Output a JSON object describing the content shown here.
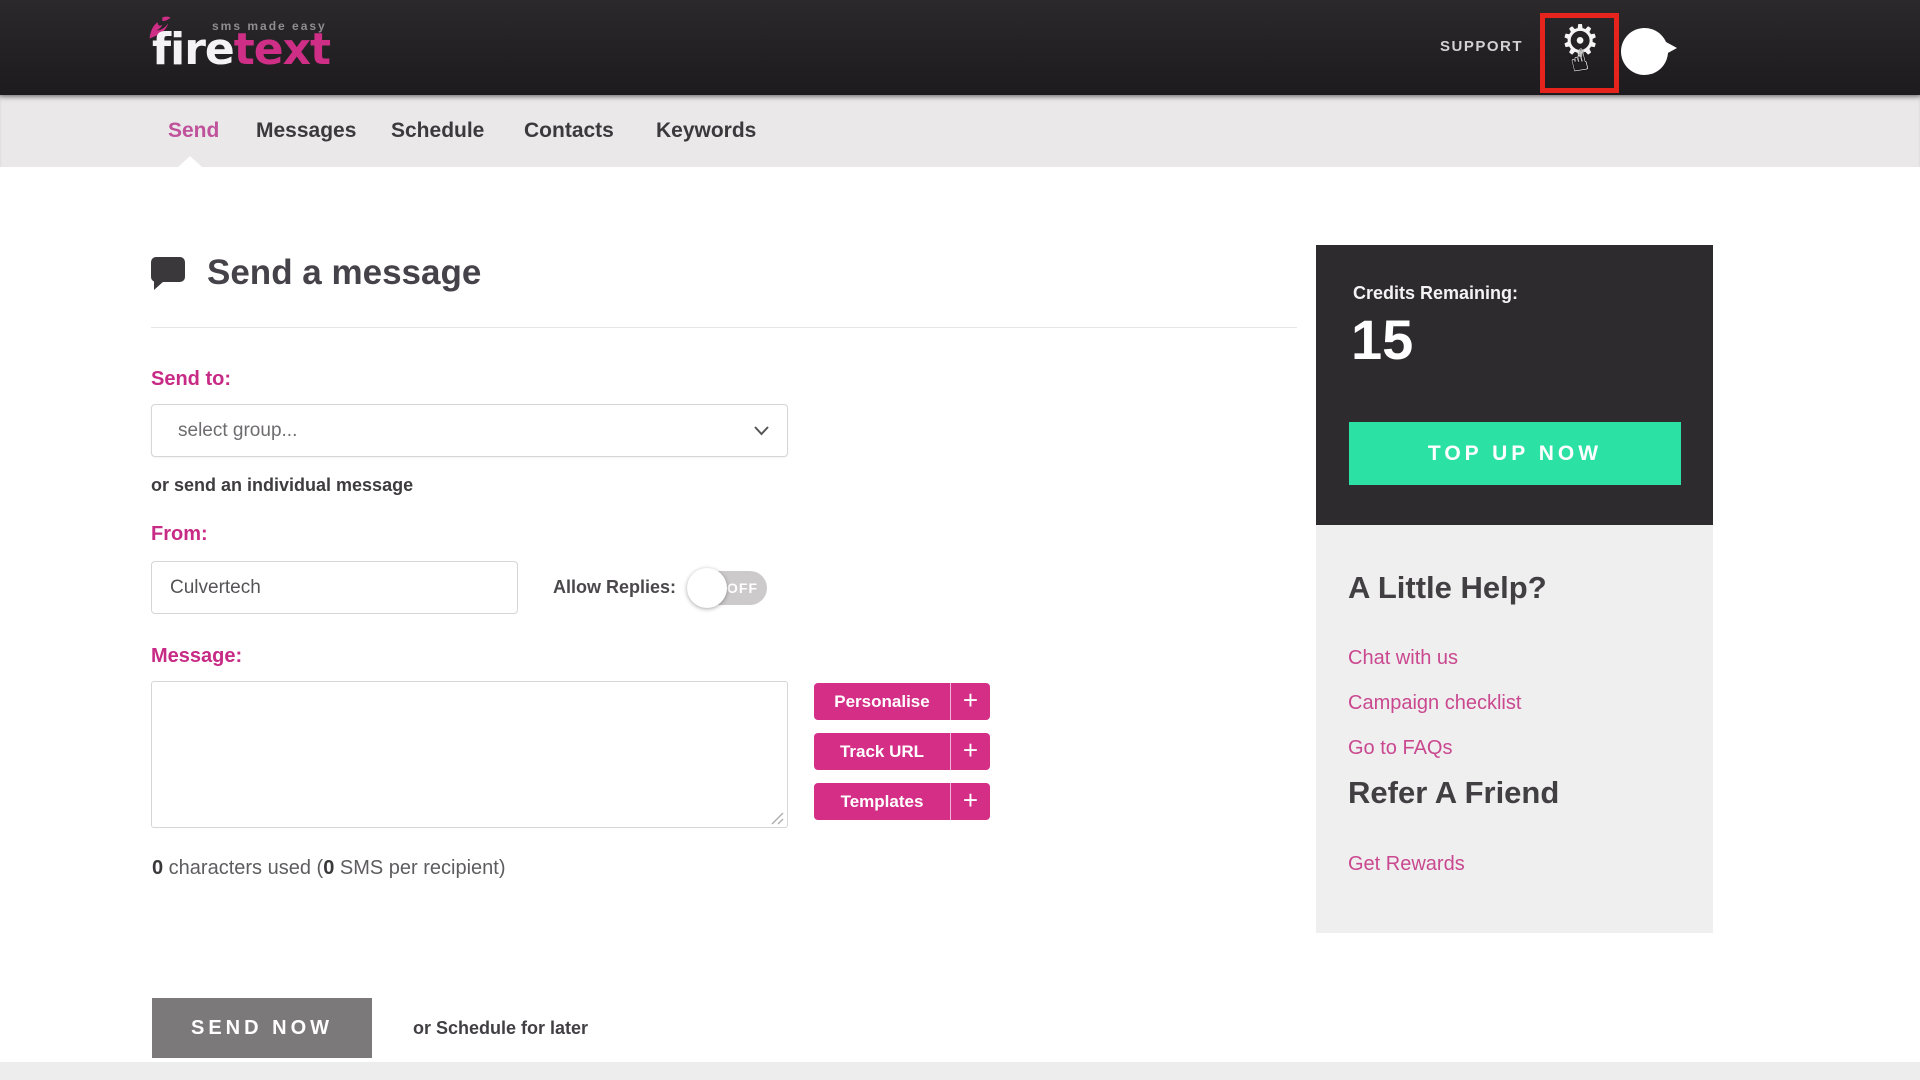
{
  "header": {
    "tagline": "sms made easy",
    "logo_fire": "fire",
    "logo_text": "text",
    "support_label": "SUPPORT"
  },
  "nav": {
    "items": [
      {
        "label": "Send",
        "active": true
      },
      {
        "label": "Messages",
        "active": false
      },
      {
        "label": "Schedule",
        "active": false
      },
      {
        "label": "Contacts",
        "active": false
      },
      {
        "label": "Keywords",
        "active": false
      }
    ]
  },
  "main": {
    "title": "Send a message",
    "send_to_label": "Send to:",
    "group_select_value": "select group...",
    "individual_note": "or send an individual message",
    "from_label": "From:",
    "from_value": "Culvertech",
    "allow_replies_label": "Allow Replies:",
    "allow_replies_state": "OFF",
    "message_label": "Message:",
    "message_value": "",
    "tools": [
      {
        "label": "Personalise"
      },
      {
        "label": "Track URL"
      },
      {
        "label": "Templates"
      }
    ],
    "tool_plus": "+",
    "chars": {
      "count": "0",
      "text1": " characters used (",
      "sms": "0",
      "text2": " SMS per recipient)"
    },
    "send_now_label": "SEND NOW",
    "schedule_note": "or Schedule for later"
  },
  "sidebar": {
    "credits_label": "Credits Remaining:",
    "credits_value": "15",
    "top_up_label": "TOP UP NOW",
    "help_title": "A Little Help?",
    "links": [
      "Chat with us",
      "Campaign checklist",
      "Go to FAQs"
    ],
    "refer_title": "Refer A Friend",
    "refer_link": "Get Rewards"
  },
  "colors": {
    "brand_pink": "#d42e87",
    "label_pink": "#c72b85",
    "link_pink": "#c9488f",
    "top_up_green": "#2be1a3",
    "highlight_red": "#e6231c",
    "header_dark": "#222022",
    "card_dark": "#2d2b2d",
    "send_now_gray": "#7b7979"
  }
}
